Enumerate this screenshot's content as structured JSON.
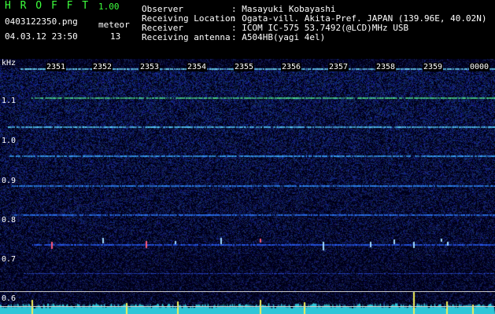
{
  "header": {
    "app_title": "H R O F F T",
    "version": "1.00",
    "filename": "0403122350.png",
    "datetime": "04.03.12 23:50",
    "meteor_label": "meteor",
    "meteor_count": "13",
    "info": [
      {
        "label": "Observer",
        "value": ": Masayuki Kobayashi"
      },
      {
        "label": "Receiving Location",
        "value": ": Ogata-vill. Akita-Pref. JAPAN (139.96E, 40.02N)"
      },
      {
        "label": "Receiver",
        "value": ": ICOM IC-575 53.7492(@LCD)MHz USB"
      },
      {
        "label": "Receiving antenna",
        "value": ": A504HB(yagi 4el)"
      }
    ]
  },
  "axis": {
    "unit": "kHz",
    "y_labels": [
      "1.1",
      "1.0",
      "0.9",
      "0.8",
      "0.7",
      "0.6"
    ],
    "time_labels": [
      "2351",
      "2352",
      "2353",
      "2354",
      "2355",
      "2356",
      "2357",
      "2358",
      "2359",
      "0000"
    ]
  },
  "colors": {
    "background": "#000000",
    "noise": "#1b3aa0",
    "line": "#3cc4ff",
    "trace": "#36c9dd",
    "header_accent": "#3dff3d"
  }
}
